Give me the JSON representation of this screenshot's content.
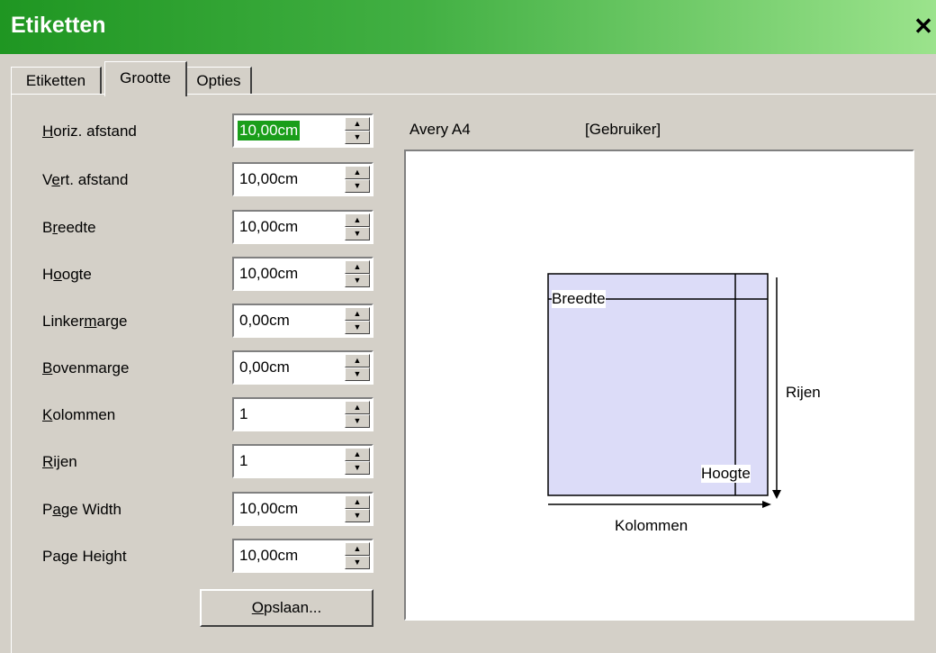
{
  "window": {
    "title": "Etiketten",
    "close_icon": "close-icon"
  },
  "tabs": [
    {
      "label": "Etiketten",
      "active": false
    },
    {
      "label": "Grootte",
      "active": true
    },
    {
      "label": "Opties",
      "active": false
    }
  ],
  "fields": [
    {
      "label_pre": "",
      "label_ul": "H",
      "label_post": "oriz. afstand",
      "value": "10,00cm",
      "selected": true
    },
    {
      "label_pre": "V",
      "label_ul": "e",
      "label_post": "rt. afstand",
      "value": "10,00cm",
      "selected": false
    },
    {
      "label_pre": "B",
      "label_ul": "r",
      "label_post": "eedte",
      "value": "10,00cm",
      "selected": false
    },
    {
      "label_pre": "H",
      "label_ul": "o",
      "label_post": "ogte",
      "value": "10,00cm",
      "selected": false
    },
    {
      "label_pre": "Linker",
      "label_ul": "m",
      "label_post": "arge",
      "value": "0,00cm",
      "selected": false
    },
    {
      "label_pre": "",
      "label_ul": "B",
      "label_post": "ovenmarge",
      "value": "0,00cm",
      "selected": false
    },
    {
      "label_pre": "",
      "label_ul": "K",
      "label_post": "olommen",
      "value": "1",
      "selected": false
    },
    {
      "label_pre": "",
      "label_ul": "R",
      "label_post": "ijen",
      "value": "1",
      "selected": false
    },
    {
      "label_pre": "P",
      "label_ul": "a",
      "label_post": "ge Width",
      "value": "10,00cm",
      "selected": false
    },
    {
      "label_pre": "Pa",
      "label_ul": "g",
      "label_post": "e Height",
      "value": "10,00cm",
      "selected": false
    }
  ],
  "save_button": {
    "label_ul": "O",
    "label_post": "pslaan..."
  },
  "label_info": {
    "brand": "Avery A4",
    "type": "[Gebruiker]"
  },
  "preview": {
    "width_label": "Breedte",
    "height_label": "Hoogte",
    "rows_label": "Rijen",
    "columns_label": "Kolommen",
    "label_fill_color": "#dcdcf8"
  },
  "colors": {
    "selection": "#1a9e1a",
    "title_gradient_start": "#1f9622",
    "title_gradient_end": "#9be38c"
  }
}
